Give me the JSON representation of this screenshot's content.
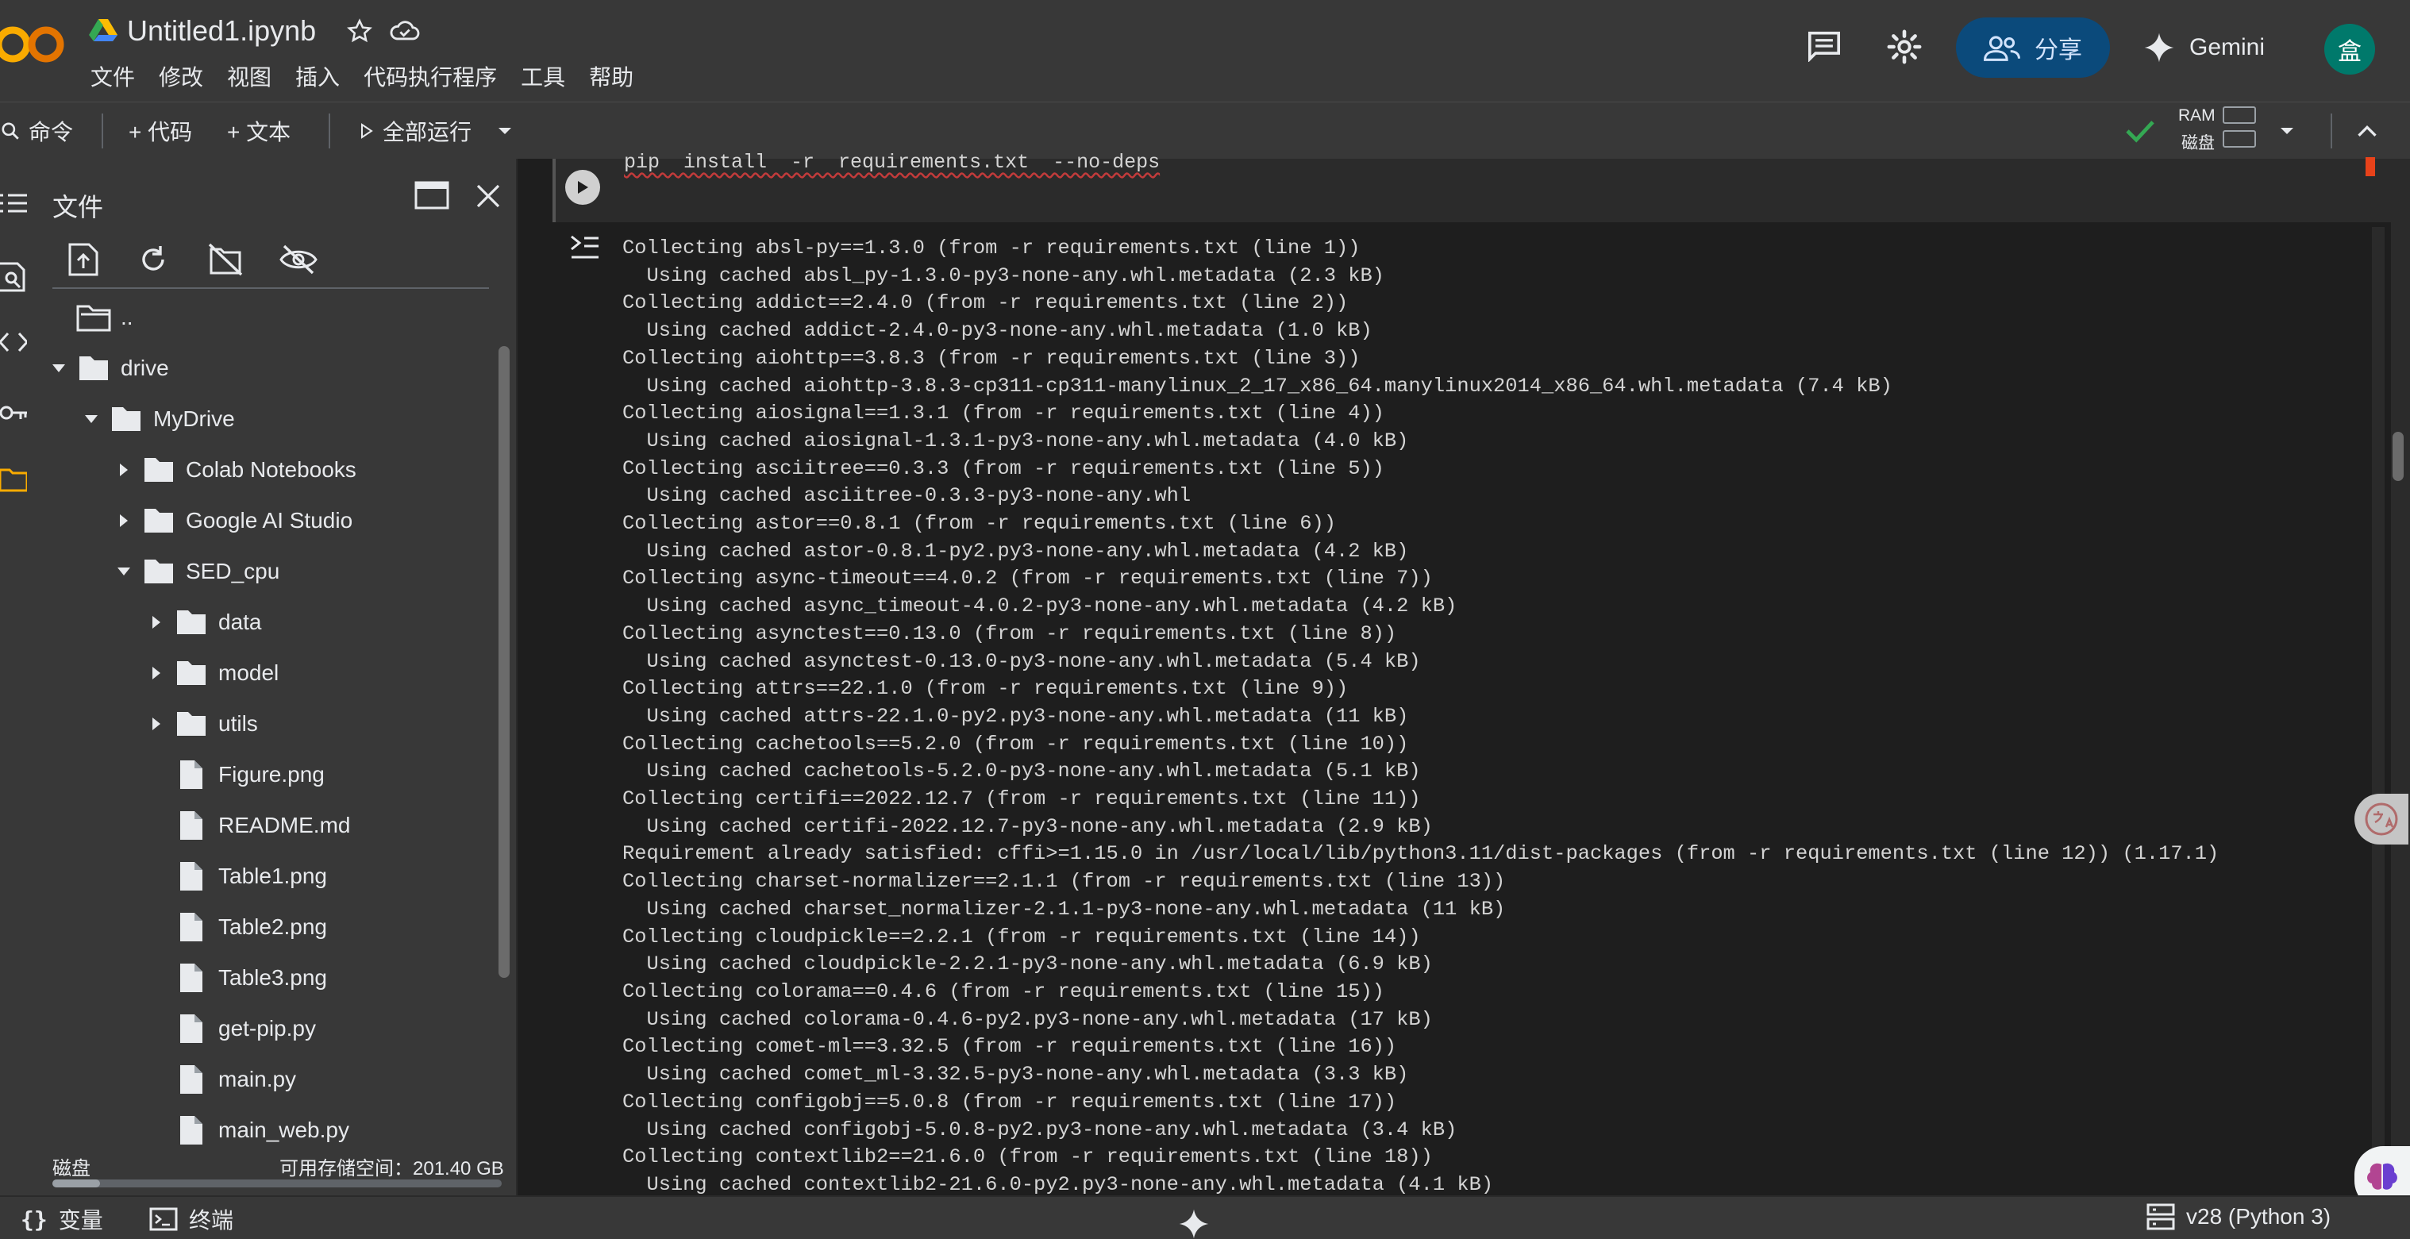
{
  "app": {
    "title": "Untitled1.ipynb",
    "logo_text": "CO",
    "menu": [
      "文件",
      "修改",
      "视图",
      "插入",
      "代码执行程序",
      "工具",
      "帮助"
    ],
    "share_label": "分享",
    "gemini_label": "Gemini",
    "avatar_initial": "盒"
  },
  "toolbar": {
    "command_label": "命令",
    "add_code_label": "+ 代码",
    "add_text_label": "+ 文本",
    "run_all_label": "全部运行",
    "ram_label": "RAM",
    "disk_label": "磁盘"
  },
  "file_panel": {
    "title": "文件",
    "tree": [
      {
        "label": "..",
        "type": "folder-up",
        "depth": 0
      },
      {
        "label": "drive",
        "type": "folder",
        "depth": 0,
        "expanded": true
      },
      {
        "label": "MyDrive",
        "type": "folder",
        "depth": 1,
        "expanded": true
      },
      {
        "label": "Colab Notebooks",
        "type": "folder",
        "depth": 2,
        "expanded": false
      },
      {
        "label": "Google AI Studio",
        "type": "folder",
        "depth": 2,
        "expanded": false
      },
      {
        "label": "SED_cpu",
        "type": "folder",
        "depth": 2,
        "expanded": true
      },
      {
        "label": "data",
        "type": "folder",
        "depth": 3,
        "expanded": false
      },
      {
        "label": "model",
        "type": "folder",
        "depth": 3,
        "expanded": false
      },
      {
        "label": "utils",
        "type": "folder",
        "depth": 3,
        "expanded": false
      },
      {
        "label": "Figure.png",
        "type": "file",
        "depth": 3
      },
      {
        "label": "README.md",
        "type": "file",
        "depth": 3
      },
      {
        "label": "Table1.png",
        "type": "file",
        "depth": 3
      },
      {
        "label": "Table2.png",
        "type": "file",
        "depth": 3
      },
      {
        "label": "Table3.png",
        "type": "file",
        "depth": 3
      },
      {
        "label": "get-pip.py",
        "type": "file",
        "depth": 3
      },
      {
        "label": "main.py",
        "type": "file",
        "depth": 3
      },
      {
        "label": "main_web.py",
        "type": "file",
        "depth": 3
      }
    ],
    "disk_label": "磁盘",
    "disk_free": "可用存储空间：201.40 GB"
  },
  "cell": {
    "code": "pip  install  -r  requirements.txt  --no-deps",
    "output_lines": [
      "Collecting absl-py==1.3.0 (from -r requirements.txt (line 1))",
      "  Using cached absl_py-1.3.0-py3-none-any.whl.metadata (2.3 kB)",
      "Collecting addict==2.4.0 (from -r requirements.txt (line 2))",
      "  Using cached addict-2.4.0-py3-none-any.whl.metadata (1.0 kB)",
      "Collecting aiohttp==3.8.3 (from -r requirements.txt (line 3))",
      "  Using cached aiohttp-3.8.3-cp311-cp311-manylinux_2_17_x86_64.manylinux2014_x86_64.whl.metadata (7.4 kB)",
      "Collecting aiosignal==1.3.1 (from -r requirements.txt (line 4))",
      "  Using cached aiosignal-1.3.1-py3-none-any.whl.metadata (4.0 kB)",
      "Collecting asciitree==0.3.3 (from -r requirements.txt (line 5))",
      "  Using cached asciitree-0.3.3-py3-none-any.whl",
      "Collecting astor==0.8.1 (from -r requirements.txt (line 6))",
      "  Using cached astor-0.8.1-py2.py3-none-any.whl.metadata (4.2 kB)",
      "Collecting async-timeout==4.0.2 (from -r requirements.txt (line 7))",
      "  Using cached async_timeout-4.0.2-py3-none-any.whl.metadata (4.2 kB)",
      "Collecting asynctest==0.13.0 (from -r requirements.txt (line 8))",
      "  Using cached asynctest-0.13.0-py3-none-any.whl.metadata (5.4 kB)",
      "Collecting attrs==22.1.0 (from -r requirements.txt (line 9))",
      "  Using cached attrs-22.1.0-py2.py3-none-any.whl.metadata (11 kB)",
      "Collecting cachetools==5.2.0 (from -r requirements.txt (line 10))",
      "  Using cached cachetools-5.2.0-py3-none-any.whl.metadata (5.1 kB)",
      "Collecting certifi==2022.12.7 (from -r requirements.txt (line 11))",
      "  Using cached certifi-2022.12.7-py3-none-any.whl.metadata (2.9 kB)",
      "Requirement already satisfied: cffi>=1.15.0 in /usr/local/lib/python3.11/dist-packages (from -r requirements.txt (line 12)) (1.17.1)",
      "Collecting charset-normalizer==2.1.1 (from -r requirements.txt (line 13))",
      "  Using cached charset_normalizer-2.1.1-py3-none-any.whl.metadata (11 kB)",
      "Collecting cloudpickle==2.2.1 (from -r requirements.txt (line 14))",
      "  Using cached cloudpickle-2.2.1-py3-none-any.whl.metadata (6.9 kB)",
      "Collecting colorama==0.4.6 (from -r requirements.txt (line 15))",
      "  Using cached colorama-0.4.6-py2.py3-none-any.whl.metadata (17 kB)",
      "Collecting comet-ml==3.32.5 (from -r requirements.txt (line 16))",
      "  Using cached comet_ml-3.32.5-py3-none-any.whl.metadata (3.3 kB)",
      "Collecting configobj==5.0.8 (from -r requirements.txt (line 17))",
      "  Using cached configobj-5.0.8-py2.py3-none-any.whl.metadata (3.4 kB)",
      "Collecting contextlib2==21.6.0 (from -r requirements.txt (line 18))",
      "  Using cached contextlib2-21.6.0-py2.py3-none-any.whl.metadata (4.1 kB)"
    ]
  },
  "statusbar": {
    "variables_label": "变量",
    "terminal_label": "终端",
    "runtime_label": "v28 (Python 3)"
  },
  "colors": {
    "accent_share": "#0b4a7b",
    "ok_green": "#34a853",
    "avatar": "#00796b",
    "logo_orange": "#f9ab00"
  }
}
